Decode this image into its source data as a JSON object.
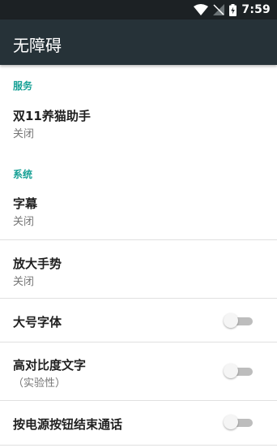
{
  "status_bar": {
    "time": "7:59"
  },
  "app_bar": {
    "title": "无障碍"
  },
  "sections": {
    "services": {
      "header": "服务",
      "items": [
        {
          "title": "双11养猫助手",
          "summary": "关闭"
        }
      ]
    },
    "system": {
      "header": "系统",
      "items": [
        {
          "title": "字幕",
          "summary": "关闭"
        },
        {
          "title": "放大手势",
          "summary": "关闭"
        },
        {
          "title": "大号字体",
          "switch": "off"
        },
        {
          "title": "高对比度文字",
          "summary": "（实验性）",
          "switch": "off"
        },
        {
          "title": "按电源按钮结束通话",
          "switch": "off"
        }
      ]
    }
  },
  "colors": {
    "app_bar": "#263238",
    "status_bar": "#1c2124",
    "accent": "#19a196"
  }
}
